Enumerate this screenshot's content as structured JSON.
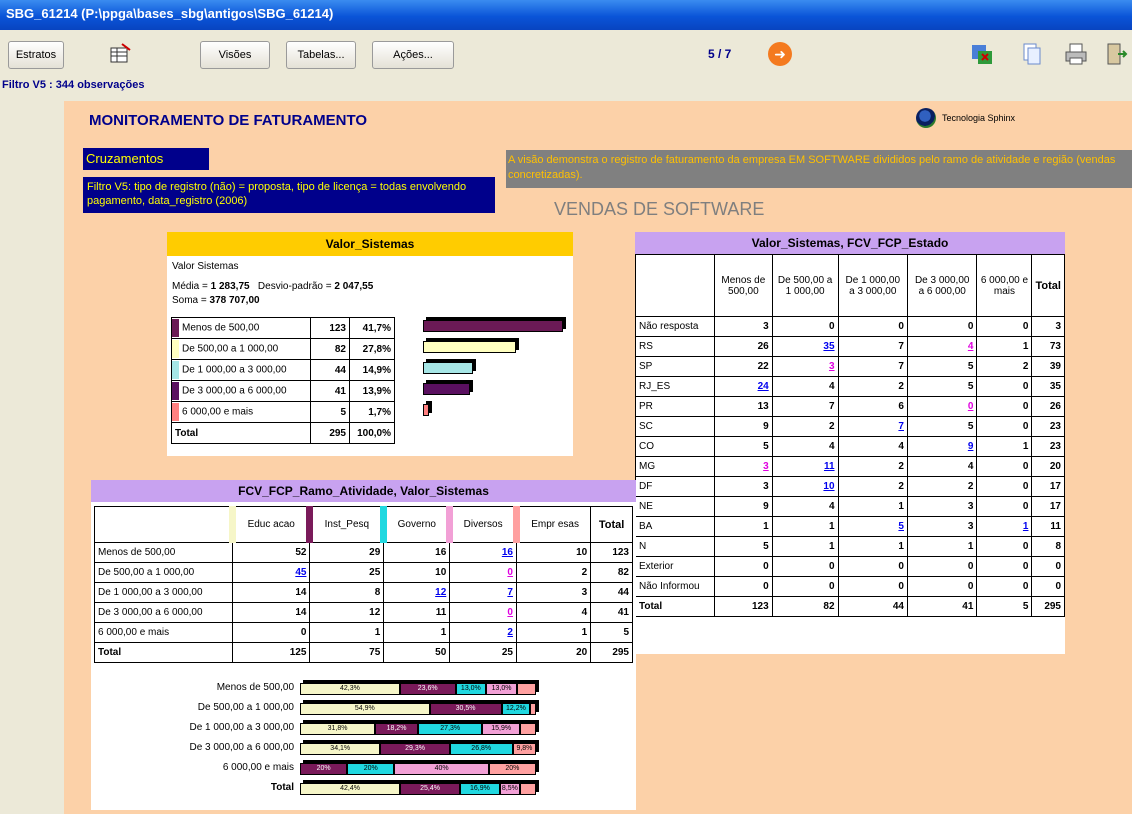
{
  "window": {
    "title": "SBG_61214 (P:\\ppga\\bases_sbg\\antigos\\SBG_61214)"
  },
  "toolbar": {
    "estratos": "Estratos",
    "visoes": "Visões",
    "tabelas": "Tabelas...",
    "acoes": "Ações...",
    "page": "5 / 7"
  },
  "filter_label": "Filtro V5 : 344 observações",
  "header": {
    "title": "MONITORAMENTO DE FATURAMENTO",
    "logo_text": "Tecnologia Sphinx"
  },
  "cruzamentos": {
    "title": "Cruzamentos",
    "filter": "Filtro V5: tipo de registro (não) = proposta, tipo de licença = todas envolvendo pagamento, data_registro (2006)"
  },
  "description": "A visão demonstra o registro de faturamento da empresa EM SOFTWARE divididos pelo ramo de atividade e região (vendas concretizadas).",
  "vendas_title": "VENDAS DE SOFTWARE",
  "colors": {
    "c1": "#6b1a56",
    "c2": "#ffffc0",
    "c3": "#a6e6e6",
    "c4": "#5a1060",
    "c5": "#ff8080",
    "bar1": "#f6f6c8",
    "bar2": "#7a1a5a",
    "bar3": "#20d8e0",
    "bar4": "#f2a0d6",
    "bar5": "#ffa0a0"
  },
  "valor_sistemas": {
    "title": "Valor_Sistemas",
    "label": "Valor Sistemas",
    "media_label": "Média = ",
    "media": "1 283,75",
    "desvio_label": "Desvio-padrão = ",
    "desvio": "2 047,55",
    "soma_label": "Soma = ",
    "soma": "378 707,00",
    "rows": [
      {
        "label": "Menos de 500,00",
        "n": "123",
        "pct": "41,7%",
        "value": 41.7
      },
      {
        "label": "De 500,00 a 1 000,00",
        "n": "82",
        "pct": "27,8%",
        "value": 27.8
      },
      {
        "label": "De 1 000,00 a 3 000,00",
        "n": "44",
        "pct": "14,9%",
        "value": 14.9
      },
      {
        "label": "De 3 000,00 a 6 000,00",
        "n": "41",
        "pct": "13,9%",
        "value": 13.9
      },
      {
        "label": "6 000,00 e mais",
        "n": "5",
        "pct": "1,7%",
        "value": 1.7
      }
    ],
    "total_label": "Total",
    "total_n": "295",
    "total_pct": "100,0%"
  },
  "estado": {
    "title": "Valor_Sistemas, FCV_FCP_Estado",
    "headers": [
      "Menos de 500,00",
      "De 500,00 a 1 000,00",
      "De 1 000,00 a 3 000,00",
      "De 3 000,00 a 6 000,00",
      "6 000,00 e mais",
      "Total"
    ],
    "rows": [
      {
        "label": "Não resposta",
        "v": [
          "3",
          "0",
          "0",
          "0",
          "0",
          "3"
        ],
        "s": [
          "",
          "",
          "",
          "",
          "",
          ""
        ]
      },
      {
        "label": "RS",
        "v": [
          "26",
          "35",
          "7",
          "4",
          "1",
          "73"
        ],
        "s": [
          "",
          "b",
          "",
          "m",
          "",
          ""
        ]
      },
      {
        "label": "SP",
        "v": [
          "22",
          "3",
          "7",
          "5",
          "2",
          "39"
        ],
        "s": [
          "",
          "m",
          "",
          "",
          "",
          ""
        ]
      },
      {
        "label": "RJ_ES",
        "v": [
          "24",
          "4",
          "2",
          "5",
          "0",
          "35"
        ],
        "s": [
          "b",
          "",
          "",
          "",
          "",
          ""
        ]
      },
      {
        "label": "PR",
        "v": [
          "13",
          "7",
          "6",
          "0",
          "0",
          "26"
        ],
        "s": [
          "",
          "",
          "",
          "m",
          "",
          ""
        ]
      },
      {
        "label": "SC",
        "v": [
          "9",
          "2",
          "7",
          "5",
          "0",
          "23"
        ],
        "s": [
          "",
          "",
          "b",
          "",
          "",
          ""
        ]
      },
      {
        "label": "CO",
        "v": [
          "5",
          "4",
          "4",
          "9",
          "1",
          "23"
        ],
        "s": [
          "",
          "",
          "",
          "b",
          "",
          ""
        ]
      },
      {
        "label": "MG",
        "v": [
          "3",
          "11",
          "2",
          "4",
          "0",
          "20"
        ],
        "s": [
          "m",
          "b",
          "",
          "",
          "",
          ""
        ]
      },
      {
        "label": "DF",
        "v": [
          "3",
          "10",
          "2",
          "2",
          "0",
          "17"
        ],
        "s": [
          "",
          "b",
          "",
          "",
          "",
          ""
        ]
      },
      {
        "label": "NE",
        "v": [
          "9",
          "4",
          "1",
          "3",
          "0",
          "17"
        ],
        "s": [
          "",
          "",
          "",
          "",
          "",
          ""
        ]
      },
      {
        "label": "BA",
        "v": [
          "1",
          "1",
          "5",
          "3",
          "1",
          "11"
        ],
        "s": [
          "",
          "",
          "b",
          "",
          "b",
          ""
        ]
      },
      {
        "label": "N",
        "v": [
          "5",
          "1",
          "1",
          "1",
          "0",
          "8"
        ],
        "s": [
          "",
          "",
          "",
          "",
          "",
          ""
        ]
      },
      {
        "label": "Exterior",
        "v": [
          "0",
          "0",
          "0",
          "0",
          "0",
          "0"
        ],
        "s": [
          "",
          "",
          "",
          "",
          "",
          ""
        ]
      },
      {
        "label": "Não Informou",
        "v": [
          "0",
          "0",
          "0",
          "0",
          "0",
          "0"
        ],
        "s": [
          "",
          "",
          "",
          "",
          "",
          ""
        ]
      },
      {
        "label": "Total",
        "v": [
          "123",
          "82",
          "44",
          "41",
          "5",
          "295"
        ],
        "s": [
          "",
          "",
          "",
          "",
          "",
          ""
        ]
      }
    ]
  },
  "ramo": {
    "title": "FCV_FCP_Ramo_Atividade, Valor_Sistemas",
    "headers": [
      "Educ acao",
      "Inst_Pesq",
      "Governo",
      "Diversos",
      "Empr esas",
      "Total"
    ],
    "rows": [
      {
        "label": "Menos de 500,00",
        "v": [
          "52",
          "29",
          "16",
          "16",
          "10",
          "123"
        ],
        "s": [
          "",
          "",
          "",
          "b",
          "",
          ""
        ]
      },
      {
        "label": "De 500,00 a 1 000,00",
        "v": [
          "45",
          "25",
          "10",
          "0",
          "2",
          "82"
        ],
        "s": [
          "b",
          "",
          "",
          "m",
          "",
          ""
        ]
      },
      {
        "label": "De 1 000,00 a 3 000,00",
        "v": [
          "14",
          "8",
          "12",
          "7",
          "3",
          "44"
        ],
        "s": [
          "",
          "",
          "b",
          "b",
          "",
          ""
        ]
      },
      {
        "label": "De 3 000,00 a 6 000,00",
        "v": [
          "14",
          "12",
          "11",
          "0",
          "4",
          "41"
        ],
        "s": [
          "",
          "",
          "",
          "m",
          "",
          ""
        ]
      },
      {
        "label": "6 000,00 e mais",
        "v": [
          "0",
          "1",
          "1",
          "2",
          "1",
          "5"
        ],
        "s": [
          "",
          "",
          "",
          "b",
          "",
          ""
        ]
      },
      {
        "label": "Total",
        "v": [
          "125",
          "75",
          "50",
          "25",
          "20",
          "295"
        ],
        "s": [
          "",
          "",
          "",
          "",
          "",
          ""
        ]
      }
    ]
  },
  "chart_data": {
    "type": "bar",
    "categories": [
      "Menos de 500,00",
      "De 500,00 a 1 000,00",
      "De 1 000,00 a 3 000,00",
      "De 3 000,00 a 6 000,00",
      "6 000,00 e mais",
      "Total"
    ],
    "series": [
      {
        "values": [
          42.3,
          54.9,
          31.8,
          34.1,
          0,
          42.4
        ],
        "labels": [
          "42,3%",
          "54,9%",
          "31,8%",
          "34,1%",
          "",
          "42,4%"
        ]
      },
      {
        "values": [
          23.6,
          30.5,
          18.2,
          29.3,
          20,
          25.4
        ],
        "labels": [
          "23,6%",
          "30,5%",
          "18,2%",
          "29,3%",
          "20%",
          "25,4%"
        ]
      },
      {
        "values": [
          13.0,
          12.2,
          27.3,
          26.8,
          20,
          16.9
        ],
        "labels": [
          "13,0%",
          "12,2%",
          "27,3%",
          "26,8%",
          "20%",
          "16,9%"
        ]
      },
      {
        "values": [
          13.0,
          0,
          15.9,
          0,
          40,
          8.5
        ],
        "labels": [
          "13,0%",
          "",
          "15,9%",
          "",
          "40%",
          "8,5%"
        ]
      },
      {
        "values": [
          8.1,
          2.4,
          6.8,
          9.8,
          20,
          6.8
        ],
        "labels": [
          "",
          "",
          "",
          "9,8%",
          "20%",
          ""
        ]
      }
    ]
  }
}
